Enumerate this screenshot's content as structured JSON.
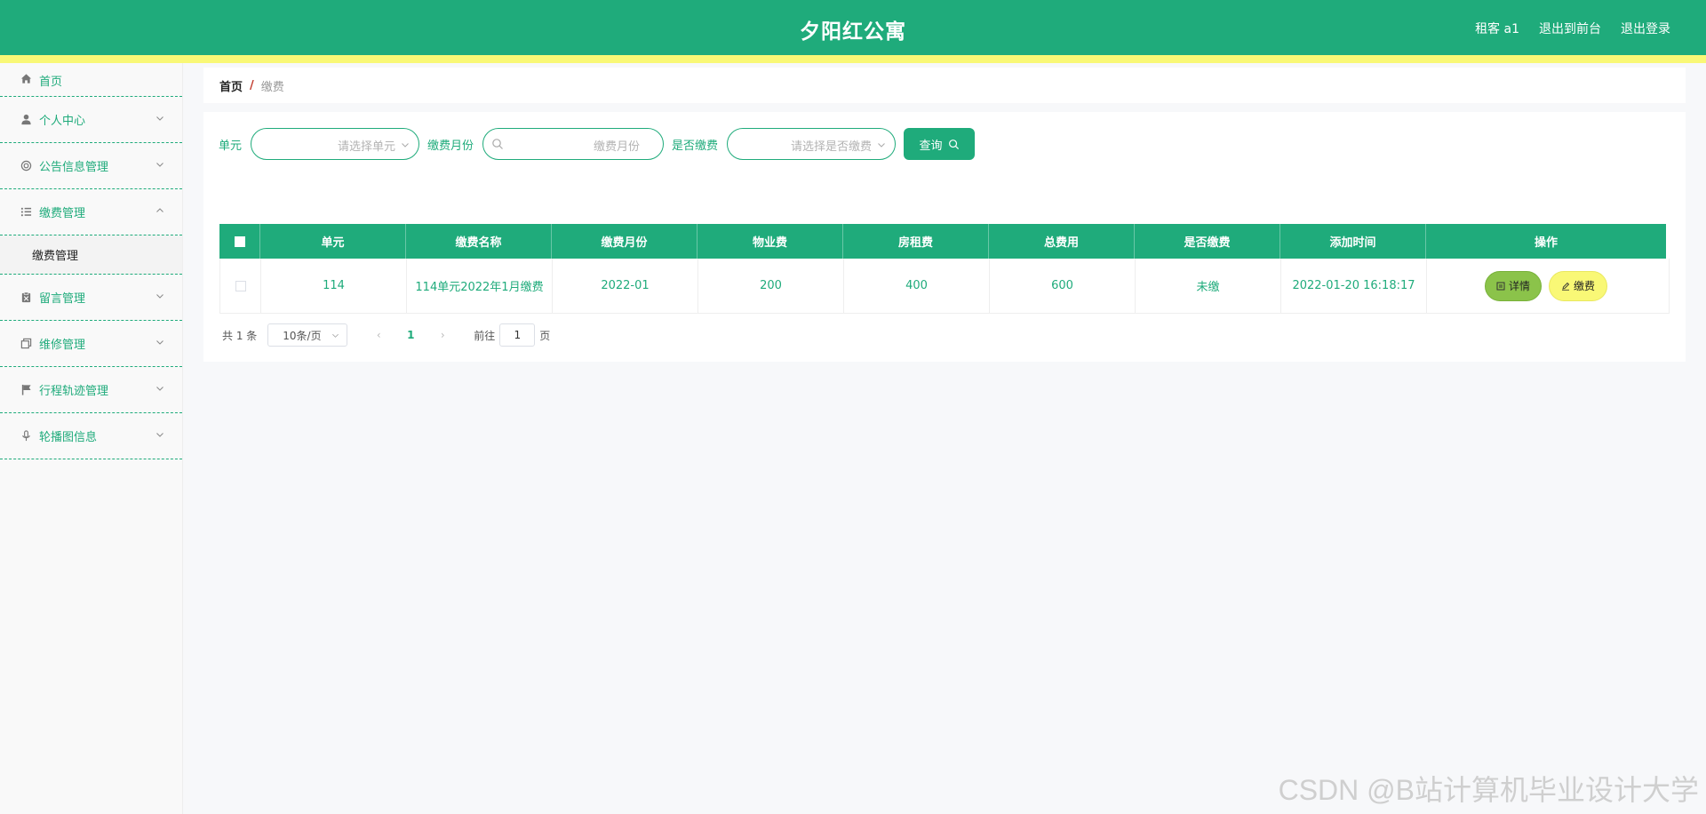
{
  "header": {
    "title": "夕阳红公寓",
    "user": "租客 a1",
    "front": "退出到前台",
    "logout": "退出登录"
  },
  "sidebar": {
    "items": [
      {
        "label": "首页",
        "icon": "home-icon"
      },
      {
        "label": "个人中心",
        "icon": "user-icon"
      },
      {
        "label": "公告信息管理",
        "icon": "notice-icon"
      },
      {
        "label": "缴费管理",
        "icon": "list-icon"
      },
      {
        "label": "留言管理",
        "icon": "message-icon"
      },
      {
        "label": "维修管理",
        "icon": "copy-icon"
      },
      {
        "label": "行程轨迹管理",
        "icon": "flag-icon"
      },
      {
        "label": "轮播图信息",
        "icon": "mic-icon"
      }
    ],
    "sub_label": "缴费管理"
  },
  "breadcrumb": {
    "home": "首页",
    "sep": "/",
    "current": "缴费"
  },
  "search": {
    "unit_label": "单元",
    "unit_placeholder": "请选择单元",
    "month_label": "缴费月份",
    "month_placeholder": "缴费月份",
    "paid_label": "是否缴费",
    "paid_placeholder": "请选择是否缴费",
    "query_label": "查询"
  },
  "table": {
    "headers": [
      "单元",
      "缴费名称",
      "缴费月份",
      "物业费",
      "房租费",
      "总费用",
      "是否缴费",
      "添加时间",
      "操作"
    ],
    "rows": [
      {
        "unit": "114",
        "name": "114单元2022年1月缴费",
        "month": "2022-01",
        "property_fee": "200",
        "rent_fee": "400",
        "total": "600",
        "paid": "未缴",
        "added": "2022-01-20 16:18:17"
      }
    ],
    "detail_label": "详情",
    "pay_label": "缴费"
  },
  "pagination": {
    "total": "共 1 条",
    "page_size": "10条/页",
    "current_page": "1",
    "goto_label": "前往",
    "goto_value": "1",
    "page_suffix": "页"
  },
  "watermark": "CSDN @B站计算机毕业设计大学",
  "colors": {
    "primary": "#1fab7b",
    "accent_yellow": "#f9f876",
    "detail_green": "#8bc34a"
  }
}
